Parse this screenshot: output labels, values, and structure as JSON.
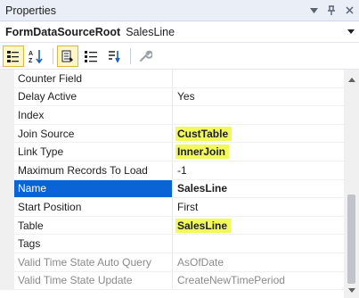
{
  "titlebar": {
    "title": "Properties",
    "icons": [
      "dropdown-icon",
      "pin-icon",
      "close-icon"
    ]
  },
  "object": {
    "name": "FormDataSourceRoot",
    "type": "SalesLine"
  },
  "toolbar": {
    "buttons": [
      "categorized-icon",
      "alphabetical-icon",
      "properties-icon",
      "events-icon",
      "sort-icon",
      "property-pages-icon"
    ]
  },
  "properties": [
    {
      "name": "Counter Field",
      "value": ""
    },
    {
      "name": "Delay Active",
      "value": "Yes"
    },
    {
      "name": "Index",
      "value": ""
    },
    {
      "name": "Join Source",
      "value": "CustTable"
    },
    {
      "name": "Link Type",
      "value": "InnerJoin"
    },
    {
      "name": "Maximum Records To Load",
      "value": "-1"
    },
    {
      "name": "Name",
      "value": "SalesLine"
    },
    {
      "name": "Start Position",
      "value": "First"
    },
    {
      "name": "Table",
      "value": "SalesLine"
    },
    {
      "name": "Tags",
      "value": ""
    },
    {
      "name": "Valid Time State Auto Query",
      "value": "AsOfDate"
    },
    {
      "name": "Valid Time State Update",
      "value": "CreateNewTimePeriod"
    }
  ],
  "colors": {
    "selection": "#0a64d6",
    "highlight": "#f2f95a",
    "disabled_text": "#8a8a8a"
  }
}
